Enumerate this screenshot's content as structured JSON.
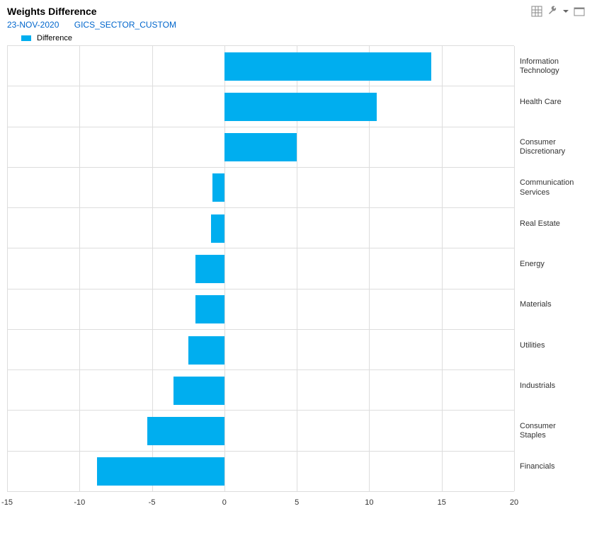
{
  "header": {
    "title": "Weights Difference",
    "date": "23-NOV-2020",
    "group": "GICS_SECTOR_CUSTOM"
  },
  "legend": {
    "series_name": "Difference"
  },
  "chart_data": {
    "type": "bar",
    "orientation": "horizontal",
    "title": "Weights Difference",
    "xlabel": "",
    "ylabel": "",
    "xlim": [
      -15,
      20
    ],
    "xticks": [
      -15,
      -10,
      -5,
      0,
      5,
      10,
      15,
      20
    ],
    "categories": [
      "Information Technology",
      "Health Care",
      "Consumer Discretionary",
      "Communication Services",
      "Real Estate",
      "Energy",
      "Materials",
      "Utilities",
      "Industrials",
      "Consumer Staples",
      "Financials"
    ],
    "series": [
      {
        "name": "Difference",
        "color": "#00aeef",
        "values": [
          14.3,
          10.5,
          5.0,
          -0.8,
          -0.9,
          -2.0,
          -2.0,
          -2.5,
          -3.5,
          -5.3,
          -8.8
        ]
      }
    ]
  }
}
